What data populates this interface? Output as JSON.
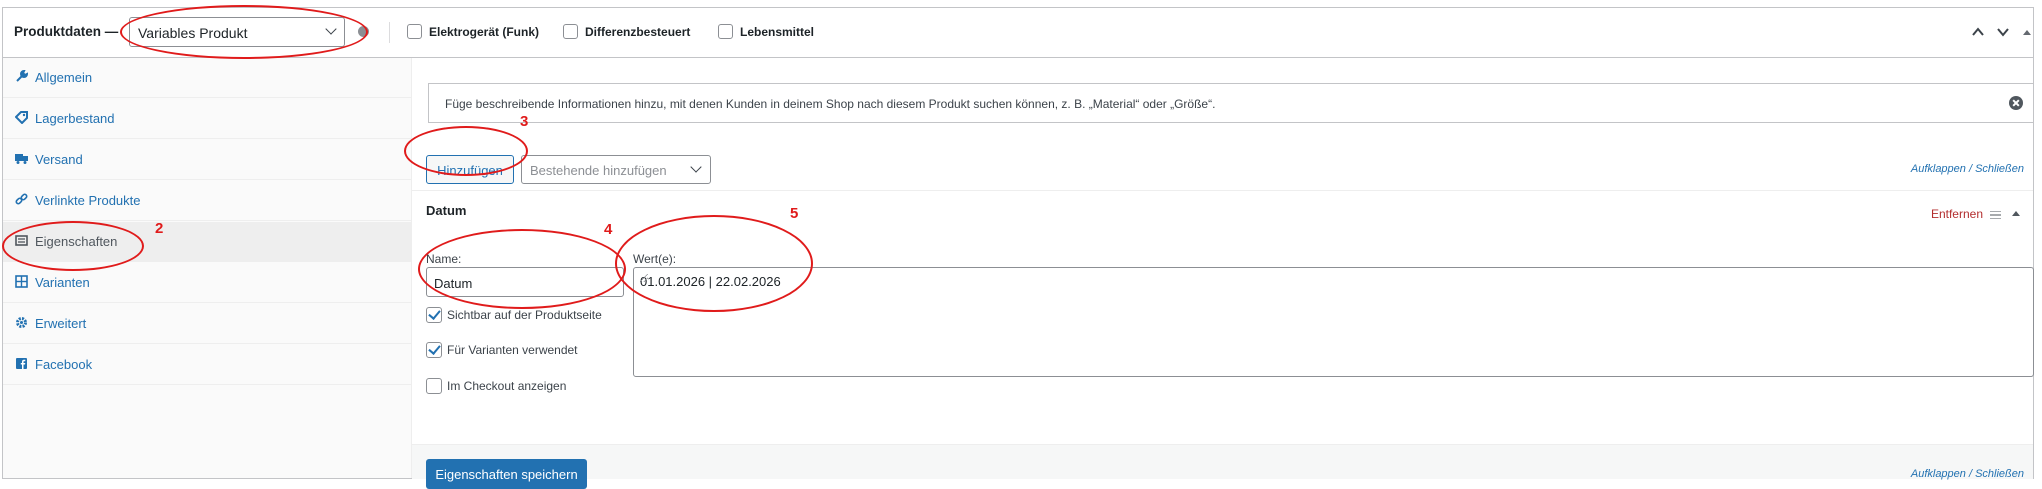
{
  "header": {
    "title": "Produktdaten —",
    "product_type": "Variables Produkt",
    "checkboxes": [
      {
        "label": "Elektrogerät (Funk)",
        "checked": false
      },
      {
        "label": "Differenzbesteuert",
        "checked": false
      },
      {
        "label": "Lebensmittel",
        "checked": false
      }
    ]
  },
  "sidebar": {
    "items": [
      {
        "label": "Allgemein",
        "icon": "wrench-icon"
      },
      {
        "label": "Lagerbestand",
        "icon": "tag-icon"
      },
      {
        "label": "Versand",
        "icon": "truck-icon"
      },
      {
        "label": "Verlinkte Produkte",
        "icon": "link-icon"
      },
      {
        "label": "Eigenschaften",
        "icon": "list-icon",
        "active": true
      },
      {
        "label": "Varianten",
        "icon": "grid-icon"
      },
      {
        "label": "Erweitert",
        "icon": "gear-icon"
      },
      {
        "label": "Facebook",
        "icon": "facebook-icon"
      }
    ]
  },
  "main": {
    "notice": "Füge beschreibende Informationen hinzu, mit denen Kunden in deinem Shop nach diesem Produkt suchen können, z. B. „Material“ oder „Größe“.",
    "add_button": "Hinzufügen",
    "existing_placeholder": "Bestehende hinzufügen",
    "expand_collapse": "Aufklappen / Schließen",
    "attribute": {
      "title": "Datum",
      "remove_label": "Entfernen",
      "name_label": "Name:",
      "name_value": "Datum",
      "values_label": "Wert(e):",
      "values_value": "01.01.2026 | 22.02.2026",
      "options": [
        {
          "label": "Sichtbar auf der Produktseite",
          "checked": true
        },
        {
          "label": "Für Varianten verwendet",
          "checked": true
        },
        {
          "label": "Im Checkout anzeigen",
          "checked": false
        }
      ]
    },
    "save_button": "Eigenschaften speichern"
  },
  "annotations": [
    "2",
    "3",
    "4",
    "5"
  ],
  "colors": {
    "accent": "#2271b1",
    "danger": "#b32d2e",
    "annotation": "#e01b1b"
  }
}
